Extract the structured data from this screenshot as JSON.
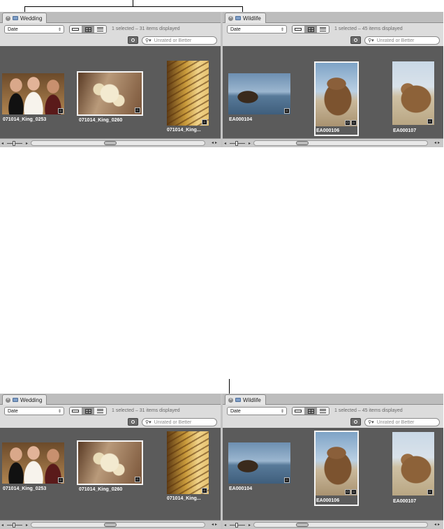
{
  "left_browser": {
    "tab_label": "Wedding",
    "sort_value": "Date",
    "status_text": "1 selected – 31 items displayed",
    "search_placeholder": "Unrated or Better",
    "thumbnails": [
      {
        "caption": "071014_King_0253",
        "selected": false
      },
      {
        "caption": "071014_King_0260",
        "selected": true
      },
      {
        "caption": "071014_King...",
        "selected": false
      }
    ]
  },
  "right_browser": {
    "tab_label": "Wildlife",
    "sort_value": "Date",
    "status_text": "1 selected – 45 items displayed",
    "search_placeholder": "Unrated or Better",
    "thumbnails": [
      {
        "caption": "EA000104",
        "selected": false
      },
      {
        "caption": "EA000106",
        "selected": true
      },
      {
        "caption": "EA000107",
        "selected": false
      }
    ]
  },
  "icons": [
    "close-icon",
    "folder-icon",
    "filmstrip-view-icon",
    "grid-view-icon",
    "list-view-icon",
    "filter-icon",
    "search-icon",
    "badge-icon"
  ],
  "colors": {
    "browser_bg": "#dcdcdc",
    "content_bg": "#5b5b5b",
    "selection_frame": "#f5f5f5"
  }
}
